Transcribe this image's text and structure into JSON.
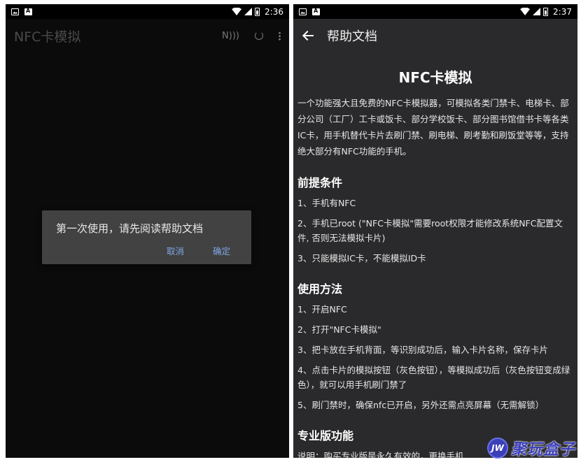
{
  "left": {
    "status_time": "2:36",
    "app_title": "NFC卡模拟",
    "nfc_icon": "nfc-icon",
    "dialog": {
      "message": "第一次使用，请先阅读帮助文档",
      "cancel": "取消",
      "ok": "确定"
    }
  },
  "right": {
    "status_time": "2:37",
    "header_title": "帮助文档",
    "doc_title": "NFC卡模拟",
    "intro": "一个功能强大且免费的NFC卡模拟器，可模拟各类门禁卡、电梯卡、部分公司（工厂）工卡或饭卡、部分学校饭卡、部分图书馆借书卡等各类IC卡，用手机替代卡片去刷门禁、刷电梯、刷考勤和刷饭堂等等，支持绝大部分有NFC功能的手机。",
    "sections": [
      {
        "heading": "前提条件",
        "items": [
          "1、手机有NFC",
          "2、手机已root (\"NFC卡模拟\"需要root权限才能修改系统NFC配置文件, 否则无法模拟卡片)",
          "3、只能模拟IC卡，不能模拟ID卡"
        ]
      },
      {
        "heading": "使用方法",
        "items": [
          "1、开启NFC",
          "2、打开\"NFC卡模拟\"",
          "3、把卡放在手机背面，等识别成功后，输入卡片名称，保存卡片",
          "4、点击卡片的模拟按钮（灰色按钮），等模拟成功后（灰色按钮变成绿色），就可以用手机刷门禁了",
          "5、刷门禁时，确保nfc已开启，另外还需点亮屏幕（无需解锁）"
        ]
      },
      {
        "heading": "专业版功能",
        "items": []
      }
    ],
    "partial_line": "说明：购买专业版是永久有效的，更换手机"
  },
  "watermark": {
    "logo": "JW",
    "text": "聚玩盒子"
  },
  "colors": {
    "dialog_bg": "#424242",
    "accent": "#7fa7e8",
    "help_bg": "#2a2a2c"
  }
}
